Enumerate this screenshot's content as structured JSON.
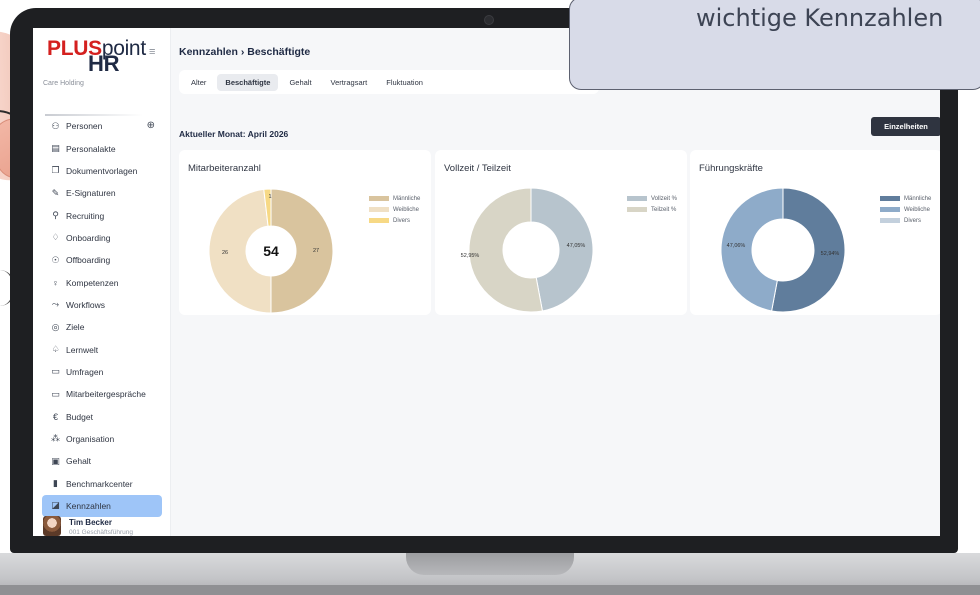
{
  "overlay": {
    "caption": "wichtige Kennzahlen"
  },
  "sidebar": {
    "logo_plus": "PLUS",
    "logo_point": "point",
    "logo_hr": "HR",
    "company": "Care Holding",
    "items": [
      {
        "label": "Personen",
        "icon": "persons-icon"
      },
      {
        "label": "Personalakte",
        "icon": "file-icon"
      },
      {
        "label": "Dokumentvorlagen",
        "icon": "document-icon"
      },
      {
        "label": "E-Signaturen",
        "icon": "pen-icon"
      },
      {
        "label": "Recruiting",
        "icon": "recruiting-icon"
      },
      {
        "label": "Onboarding",
        "icon": "onboarding-icon"
      },
      {
        "label": "Offboarding",
        "icon": "offboarding-icon"
      },
      {
        "label": "Kompetenzen",
        "icon": "bulb-icon"
      },
      {
        "label": "Workflows",
        "icon": "workflow-icon"
      },
      {
        "label": "Ziele",
        "icon": "target-icon"
      },
      {
        "label": "Lernwelt",
        "icon": "graduation-icon"
      },
      {
        "label": "Umfragen",
        "icon": "survey-icon"
      },
      {
        "label": "Mitarbeitergespräche",
        "icon": "chat-icon"
      },
      {
        "label": "Budget",
        "icon": "euro-icon"
      },
      {
        "label": "Organisation",
        "icon": "org-icon"
      },
      {
        "label": "Gehalt",
        "icon": "money-icon"
      },
      {
        "label": "Benchmarkcenter",
        "icon": "bar-chart-icon"
      },
      {
        "label": "Kennzahlen",
        "icon": "chart-icon",
        "active": true
      }
    ],
    "user": {
      "name": "Tim Becker",
      "role": "001 Geschäftsführung"
    }
  },
  "header": {
    "breadcrumb": "Kennzahlen › Beschäftigte",
    "tabs": [
      "Alter",
      "Beschäftigte",
      "Gehalt",
      "Vertragsart",
      "Fluktuation"
    ],
    "active_tab": "Beschäftigte"
  },
  "main": {
    "month_label": "Aktueller Monat: April 2026",
    "details_button": "Einzelheiten"
  },
  "chart_data": [
    {
      "type": "pie",
      "title": "Mitarbeiteranzahl",
      "center_label": "54",
      "categories": [
        "Männliche",
        "Weibliche",
        "Divers"
      ],
      "values": [
        27,
        26,
        1
      ],
      "value_labels": [
        "27",
        "26",
        "1"
      ],
      "colors": [
        "#d9c49e",
        "#f0e0c4",
        "#f7d985"
      ],
      "legend": "top-right"
    },
    {
      "type": "pie",
      "title": "Vollzeit / Teilzeit",
      "categories": [
        "Vollzeit %",
        "Teilzeit %"
      ],
      "values": [
        47.05,
        52.95
      ],
      "value_labels": [
        "47,05%",
        "52,95%"
      ],
      "colors": [
        "#b7c4cd",
        "#d8d5c6"
      ],
      "legend": "top-right"
    },
    {
      "type": "pie",
      "title": "Führungskräfte",
      "categories": [
        "Männliche",
        "Weibliche",
        "Divers"
      ],
      "values": [
        52.94,
        47.06,
        0
      ],
      "value_labels": [
        "52,94%",
        "47,06%",
        ""
      ],
      "colors": [
        "#607d9c",
        "#8eabc9",
        "#c3d0dd"
      ],
      "legend": "top-right"
    }
  ]
}
